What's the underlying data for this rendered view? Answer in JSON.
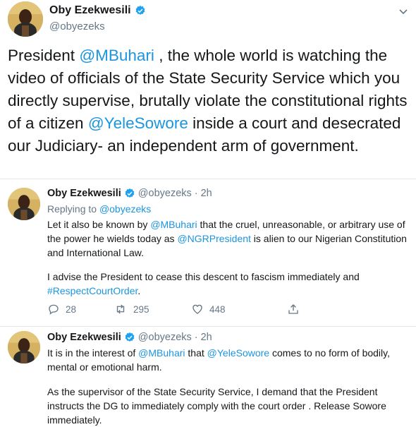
{
  "main_tweet": {
    "name": "Oby Ezekwesili",
    "handle": "@obyezeks",
    "text_parts": [
      "President ",
      "@MBuhari",
      " , the whole world is watching the video of officials of the State Security Service which you directly supervise,  brutally violate the constitutional rights of a citizen ",
      "@YeleSowore",
      " inside a court and desecrated our Judiciary- an independent arm of government."
    ]
  },
  "replies": [
    {
      "name": "Oby Ezekwesili",
      "handle": "@obyezeks",
      "time": "· 2h",
      "replying_label": "Replying to ",
      "replying_to": "@obyezeks",
      "text_parts": [
        "Let it also be known by ",
        "@MBuhari",
        " that the cruel, unreasonable, or arbitrary use of the power he wields today as ",
        "@NGRPresident",
        " is alien to our Nigerian Constitution and International Law."
      ],
      "text2_parts": [
        "I advise the President to cease this descent to fascism immediately and ",
        "#RespectCourtOrder",
        "."
      ],
      "reply_count": "28",
      "retweet_count": "295",
      "like_count": "448"
    },
    {
      "name": "Oby Ezekwesili",
      "handle": "@obyezeks",
      "time": "· 2h",
      "text_parts": [
        "It is in the interest of ",
        "@MBuhari",
        " that ",
        "@YeleSowore",
        " comes to no form of bodily, mental or emotional harm."
      ],
      "text2": "As the supervisor of the State Security Service, I demand that the President instructs the DG to immediately comply with the court order . Release Sowore immediately."
    }
  ],
  "colors": {
    "link": "#1b95e0",
    "muted": "#657786",
    "verified": "#1da1f2"
  }
}
